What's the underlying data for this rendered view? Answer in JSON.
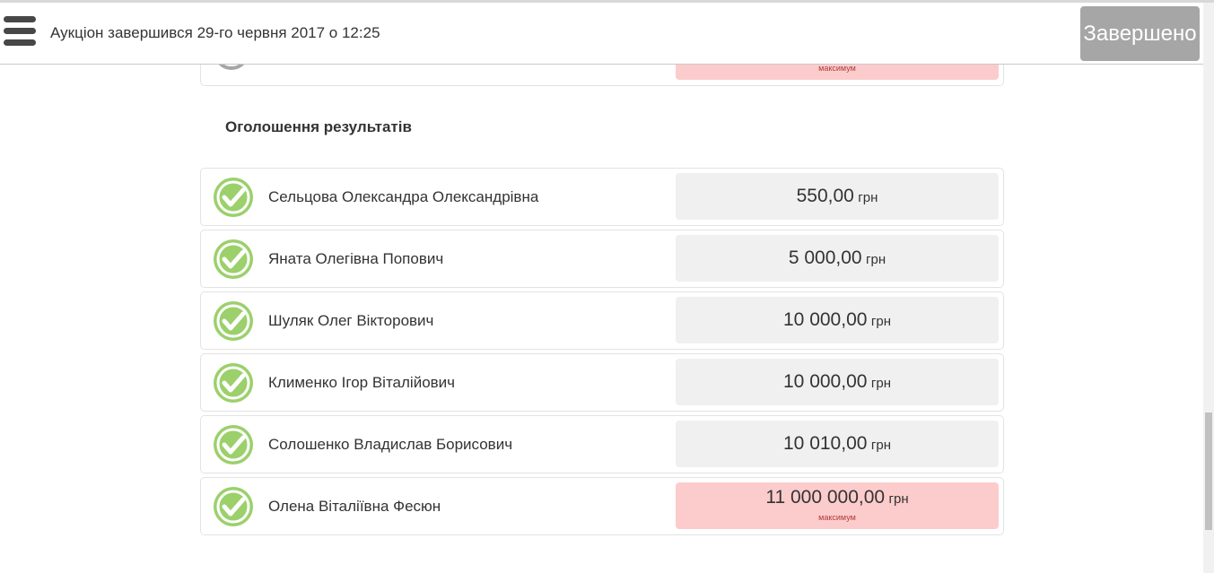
{
  "header": {
    "title": "Аукціон завершився 29-го червня 2017 о 12:25",
    "status_label": "Завершено"
  },
  "prev_row": {
    "max_label": "максимум"
  },
  "results": {
    "section_title": "Оголошення результатів",
    "currency": "грн",
    "max_label": "максимум",
    "rows": [
      {
        "name": "Сельцова Олександра Олександрівна",
        "amount": "550,00",
        "is_max": false
      },
      {
        "name": "Яната Олегівна Попович",
        "amount": "5 000,00",
        "is_max": false
      },
      {
        "name": "Шуляк Олег Вікторович",
        "amount": "10 000,00",
        "is_max": false
      },
      {
        "name": "Клименко Ігор Віталійович",
        "amount": "10 000,00",
        "is_max": false
      },
      {
        "name": "Солошенко Владислав Борисович",
        "amount": "10 010,00",
        "is_max": false
      },
      {
        "name": "Олена Віталіївна Фесюн",
        "amount": "11 000 000,00",
        "is_max": true
      }
    ]
  },
  "colors": {
    "check_green": "#9bd06b",
    "max_bg": "#fccccc",
    "bid_bg": "#f0f0f0",
    "status_bg": "#a6a6a6"
  },
  "icons": {
    "menu": "hamburger-menu-icon",
    "check": "check-circle-icon"
  }
}
